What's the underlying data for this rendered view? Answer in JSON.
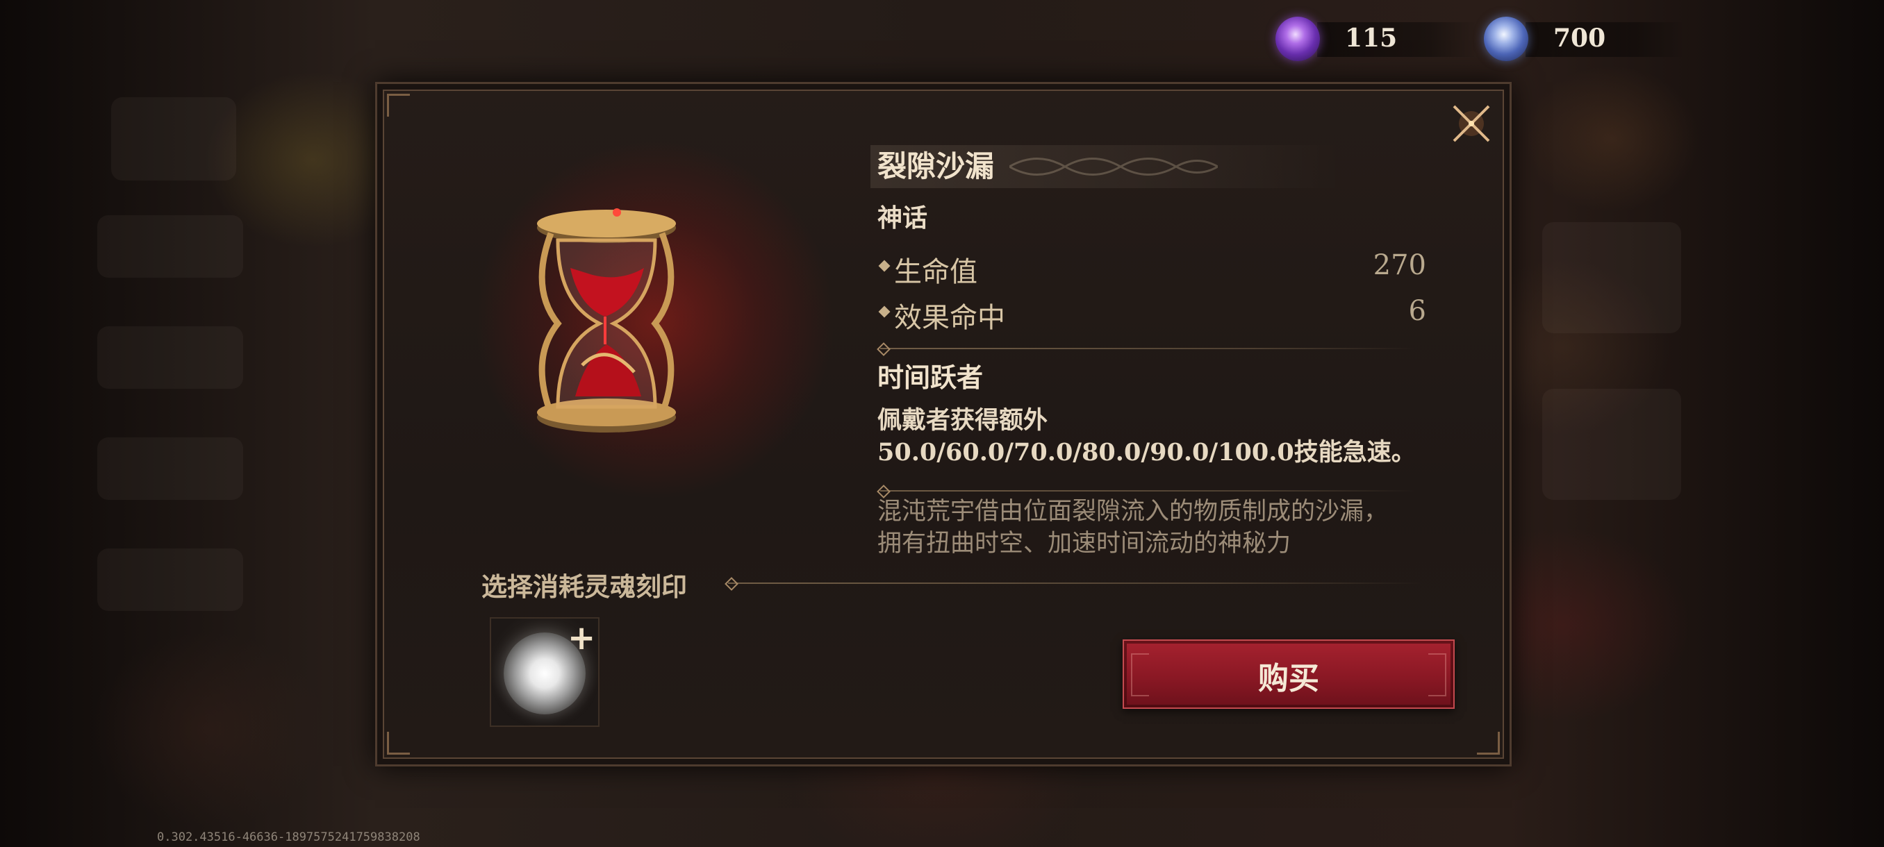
{
  "currencies": [
    {
      "icon": "purple-soul-crystal-icon",
      "amount": "115",
      "color": "#9b5de0"
    },
    {
      "icon": "blue-soul-crystal-icon",
      "amount": "700",
      "color": "#6f88d8"
    }
  ],
  "item": {
    "name": "裂隙沙漏",
    "rarity": "神话",
    "image": "hourglass-icon",
    "stats": [
      {
        "name": "生命值",
        "value": "270"
      },
      {
        "name": "效果命中",
        "value": "6"
      }
    ],
    "skill": {
      "name": "时间跃者",
      "description": "佩戴者获得额外50.0/60.0/70.0/80.0/90.0/100.0技能急速。"
    },
    "lore": "混沌荒宇借由位面裂隙流入的物质制成的沙漏，拥有扭曲时空、加速时间流动的神秘力"
  },
  "soul_section": {
    "label": "选择消耗灵魂刻印",
    "slot_icon": "soul-imprint-orb-icon",
    "add_icon": "plus-icon"
  },
  "actions": {
    "buy_label": "购买",
    "close_icon": "close-icon"
  },
  "colors": {
    "buy_button": "#8a1824",
    "panel": "#1f1815",
    "accent_gold": "#c8b08a"
  },
  "version": "0.302.43516-46636-18975752417598382​08"
}
